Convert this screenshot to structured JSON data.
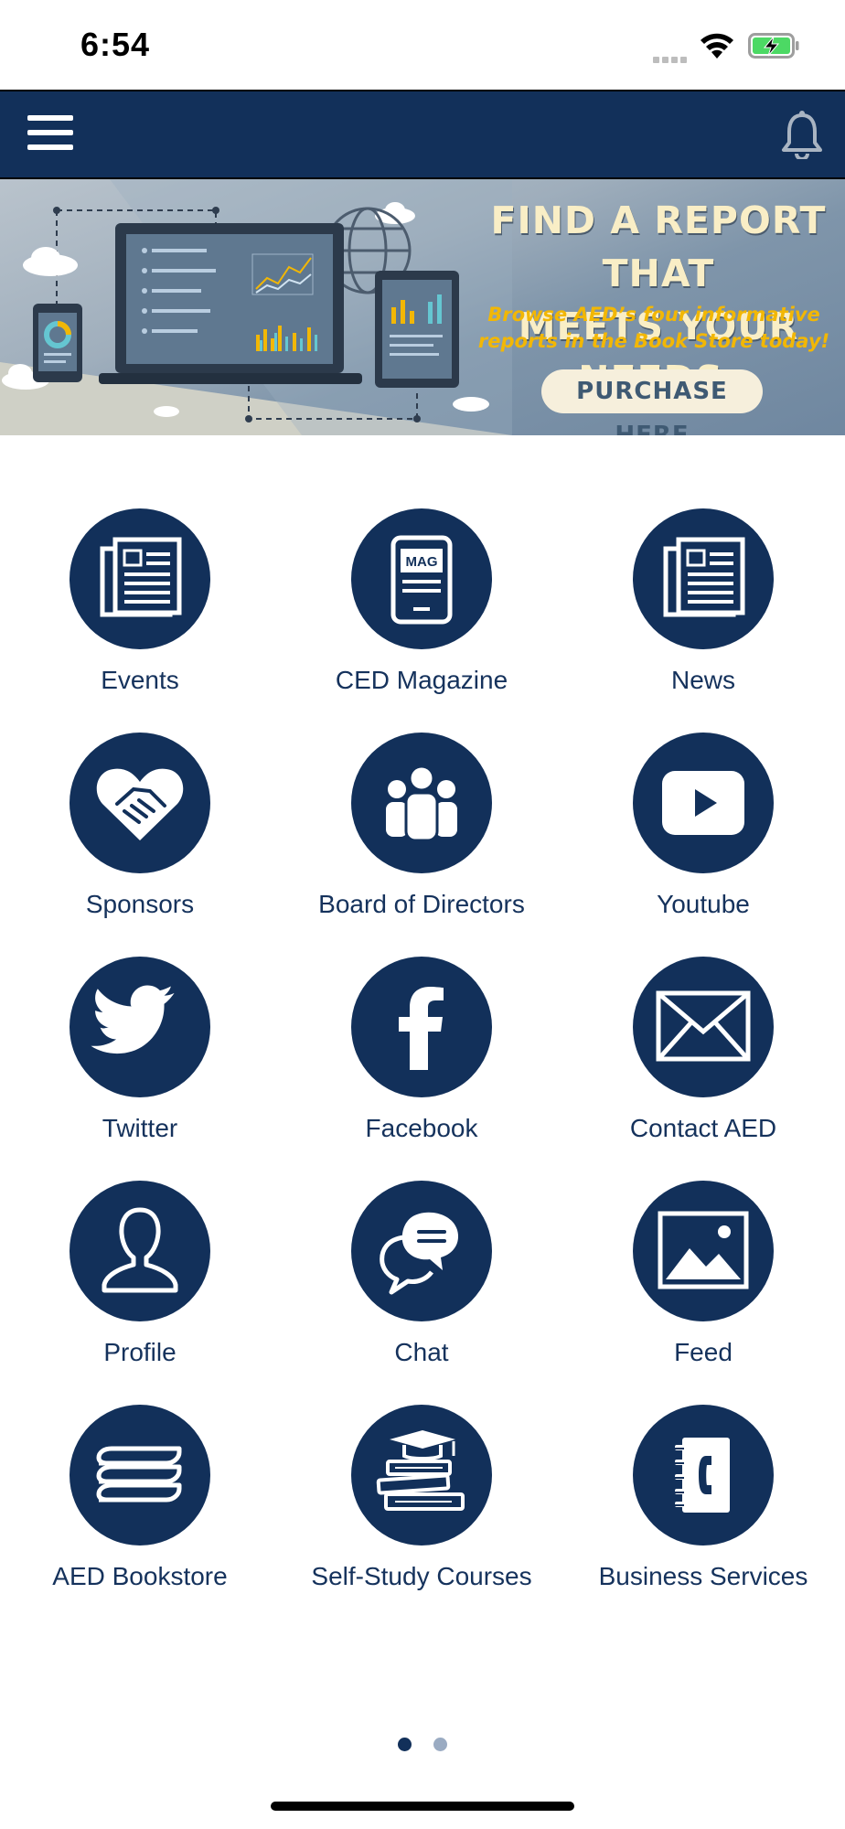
{
  "status_bar": {
    "time": "6:54"
  },
  "banner": {
    "title_line1": "FIND A REPORT THAT",
    "title_line2": "MEETS YOUR NEEDS.",
    "subtitle_line1": "Browse AED’s four informative",
    "subtitle_line2": "reports in the Book Store today!",
    "cta": "PURCHASE HERE"
  },
  "tiles": [
    {
      "label": "Events",
      "icon": "newspaper-icon"
    },
    {
      "label": "CED Magazine",
      "icon": "magazine-icon",
      "icon_text": "MAG"
    },
    {
      "label": "News",
      "icon": "newspaper-icon"
    },
    {
      "label": "Sponsors",
      "icon": "heart-handshake-icon"
    },
    {
      "label": "Board of Directors",
      "icon": "people-group-icon"
    },
    {
      "label": "Youtube",
      "icon": "youtube-icon"
    },
    {
      "label": "Twitter",
      "icon": "twitter-bird-icon"
    },
    {
      "label": "Facebook",
      "icon": "facebook-icon"
    },
    {
      "label": "Contact AED",
      "icon": "envelope-icon"
    },
    {
      "label": "Profile",
      "icon": "person-icon"
    },
    {
      "label": "Chat",
      "icon": "chat-bubbles-icon"
    },
    {
      "label": "Feed",
      "icon": "image-icon"
    },
    {
      "label": "AED Bookstore",
      "icon": "books-stack-icon"
    },
    {
      "label": "Self-Study Courses",
      "icon": "graduation-books-icon"
    },
    {
      "label": "Business Services",
      "icon": "phone-directory-icon"
    }
  ],
  "pager": {
    "pages": 2,
    "current": 1
  },
  "colors": {
    "primary": "#12305a",
    "accent": "#f2b705",
    "background": "#ffffff"
  }
}
